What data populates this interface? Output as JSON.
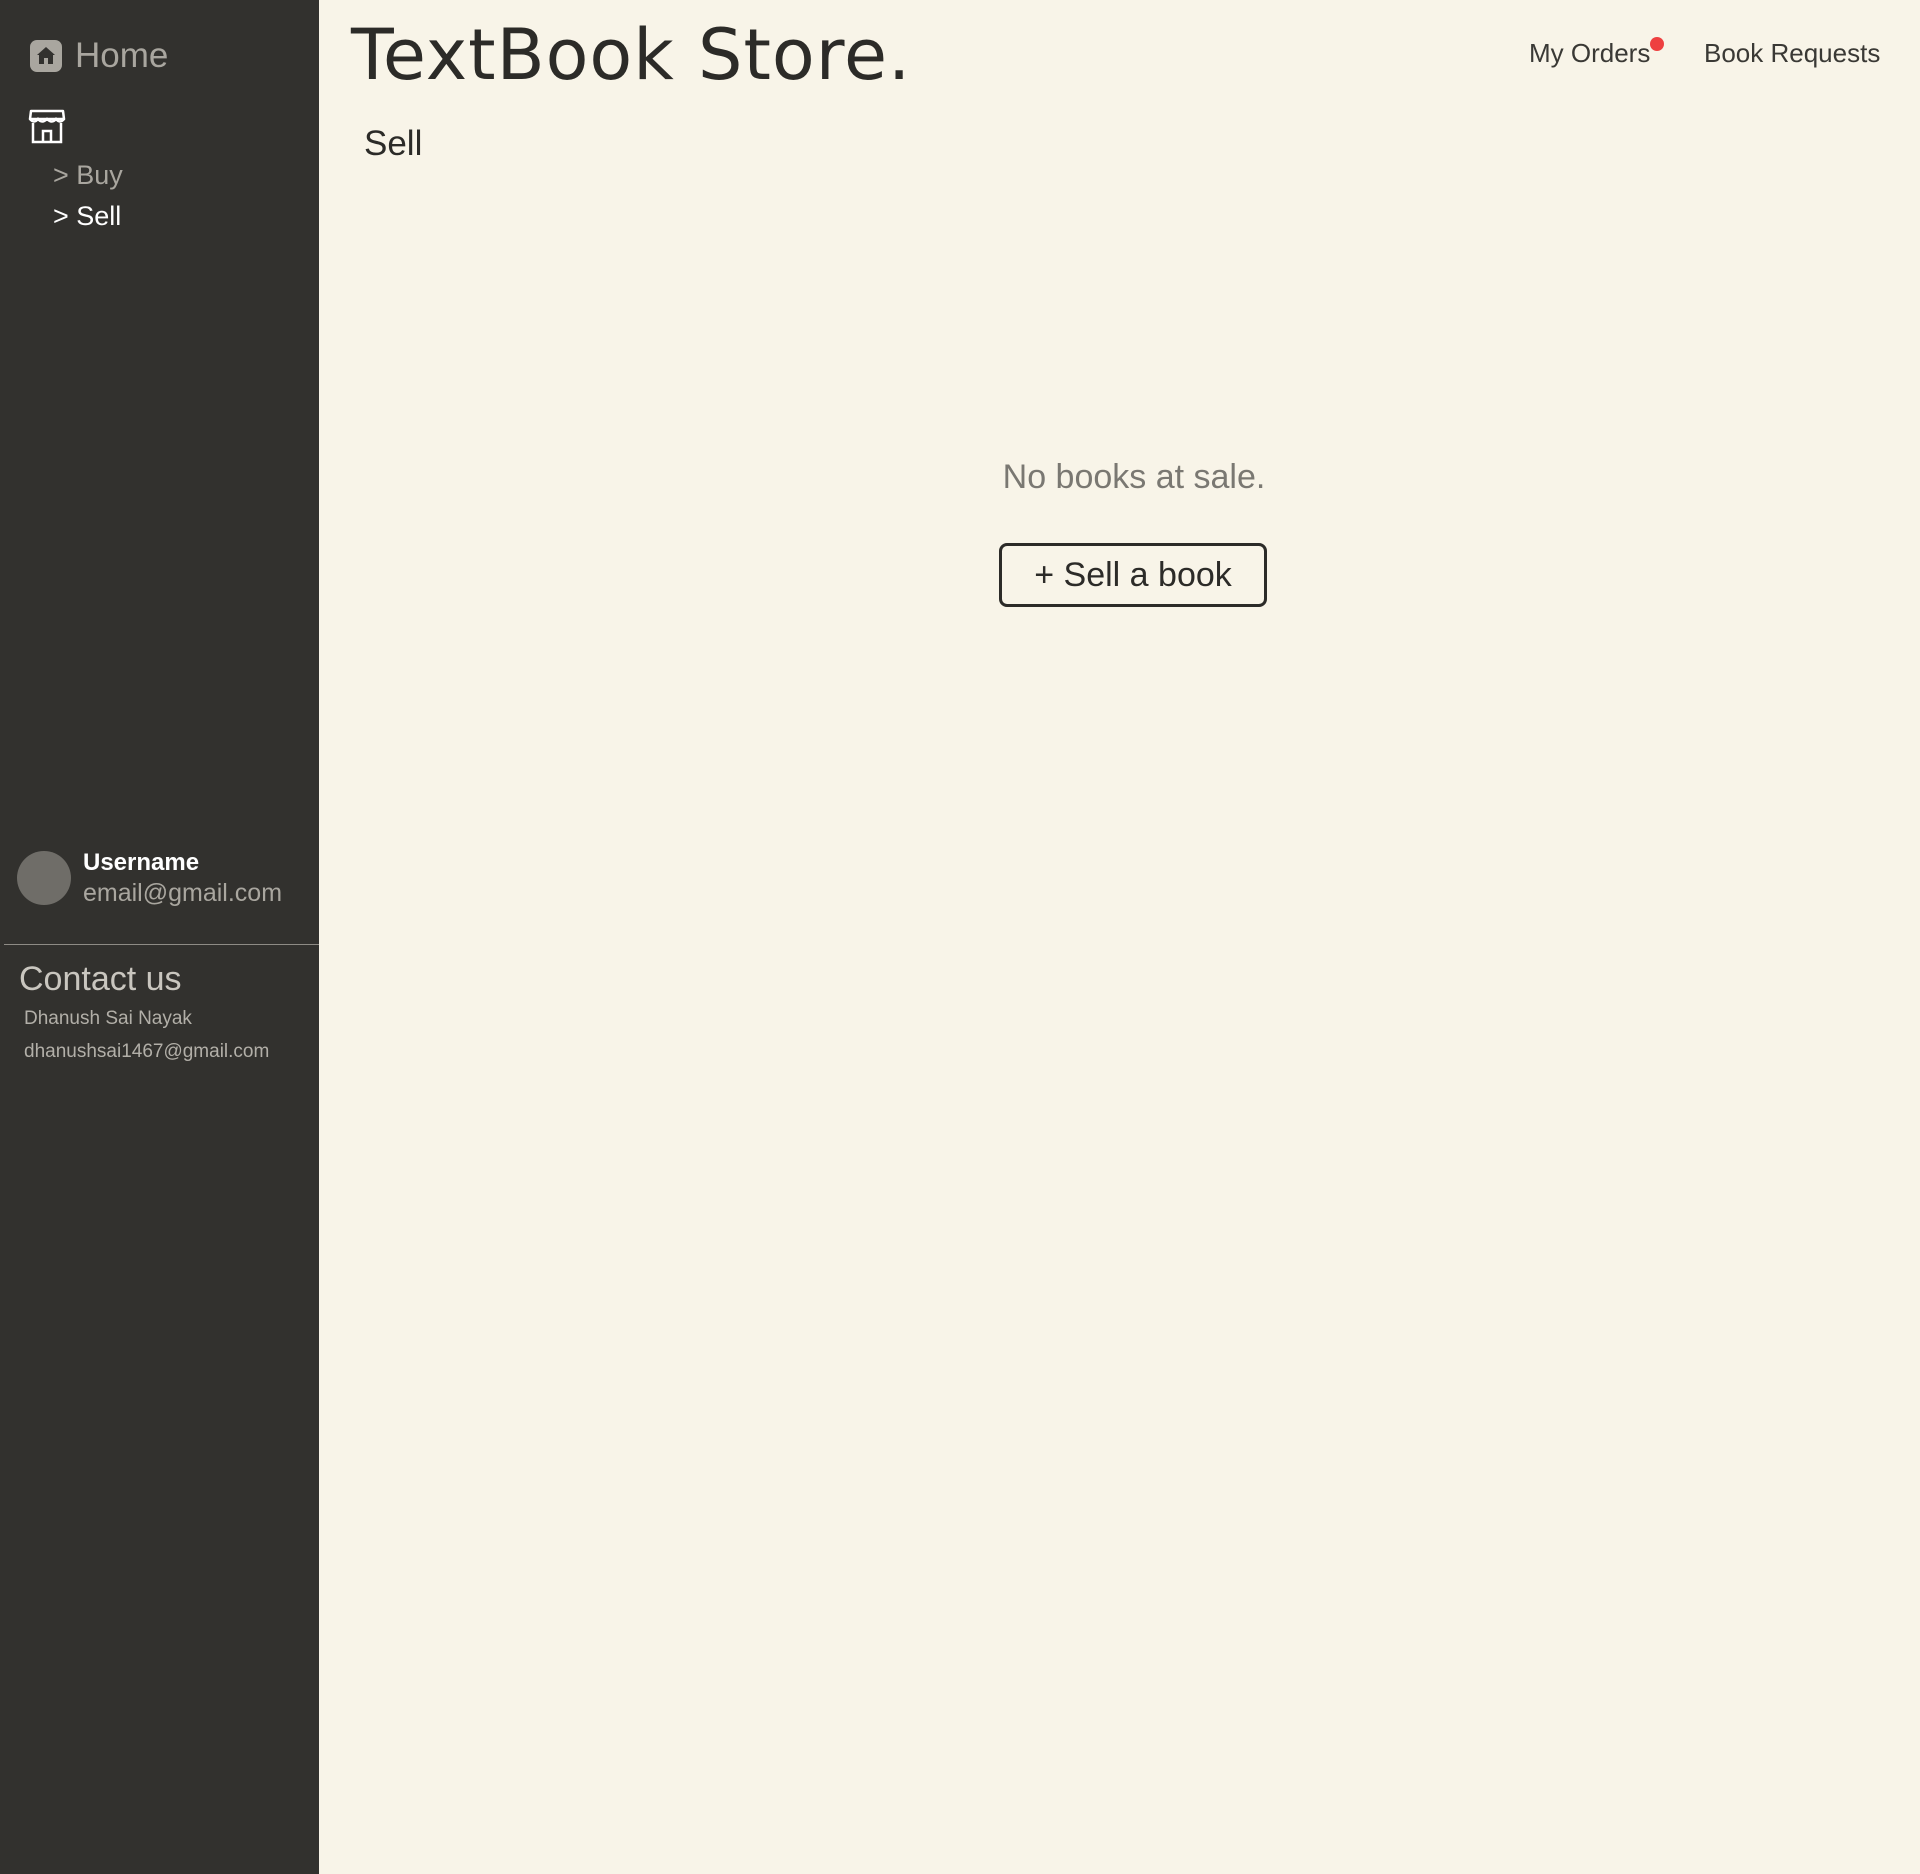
{
  "app": {
    "brand": "TextBook Store."
  },
  "sidebar": {
    "home_label": "Home",
    "home_icon": "home-icon",
    "store_icon": "storefront-icon",
    "sub_items": [
      {
        "label": "> Buy",
        "active": false
      },
      {
        "label": "> Sell",
        "active": true
      }
    ],
    "user": {
      "name": "Username",
      "email": "email@gmail.com"
    },
    "contact": {
      "title": "Contact us",
      "name": "Dhanush Sai Nayak",
      "email": "dhanushsai1467@gmail.com"
    }
  },
  "header": {
    "links": [
      {
        "label": "My Orders",
        "has_notification": true
      },
      {
        "label": "Book Requests"
      }
    ]
  },
  "main": {
    "title": "Sell",
    "empty_message": "No books at sale.",
    "sell_button_label": "+ Sell a book"
  },
  "colors": {
    "sidebar_bg": "#32312e",
    "page_bg": "#f8f4e8",
    "text_dark": "#2c2b28",
    "notification": "#ee4040"
  }
}
